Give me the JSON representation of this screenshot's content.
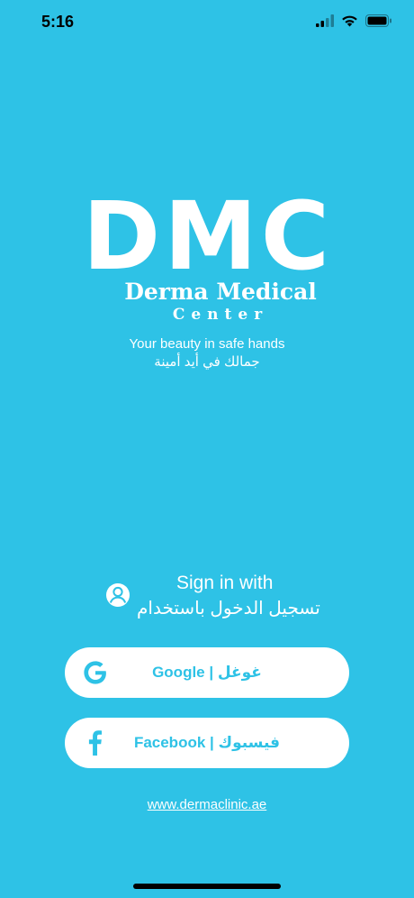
{
  "status_bar": {
    "time": "5:16"
  },
  "logo": {
    "letters": "DMC",
    "line1": "Derma Medical",
    "line2": "Center"
  },
  "tagline": {
    "en": "Your beauty in safe hands",
    "ar": "جمالك في أيد أمينة"
  },
  "sign_in": {
    "en": "Sign in with",
    "ar": "تسجيل الدخول باستخدام",
    "icon": "user-circle-icon"
  },
  "buttons": {
    "google": {
      "label": "Google | غوغل",
      "icon": "google-icon",
      "brand_color": "#2ec2e6"
    },
    "facebook": {
      "label": "Facebook | فيسبوك",
      "icon": "facebook-icon",
      "brand_color": "#2ec2e6"
    }
  },
  "website": "www.dermaclinic.ae",
  "colors": {
    "background": "#2ec2e6",
    "button": "#ffffff",
    "text": "#ffffff"
  }
}
